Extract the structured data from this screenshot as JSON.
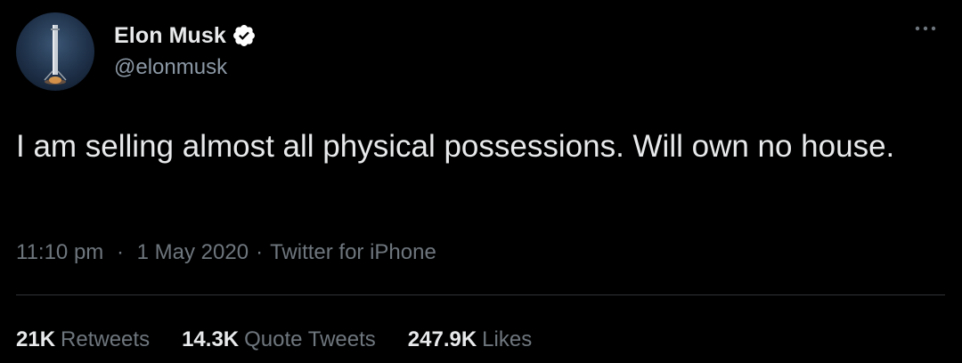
{
  "author": {
    "display_name": "Elon Musk",
    "handle": "@elonmusk",
    "verified_icon": "verified-badge-icon",
    "avatar": "falcon-rocket-landing-avatar"
  },
  "menu": {
    "icon": "more-horizontal-icon"
  },
  "tweet": {
    "text": "I am selling almost all physical possessions. Will own no house."
  },
  "meta": {
    "time": "11:10 pm",
    "separator": "·",
    "date": "1 May 2020",
    "source": "Twitter for iPhone"
  },
  "stats": {
    "retweets_count": "21K",
    "retweets_label": "Retweets",
    "quotes_count": "14.3K",
    "quotes_label": "Quote Tweets",
    "likes_count": "247.9K",
    "likes_label": "Likes"
  },
  "colors": {
    "background": "#000000",
    "primary_text": "#e7e9ea",
    "secondary_text": "#6e767d",
    "handle_text": "#8b98a5",
    "divider": "#2f3336",
    "verified_fill": "#ffffff"
  }
}
